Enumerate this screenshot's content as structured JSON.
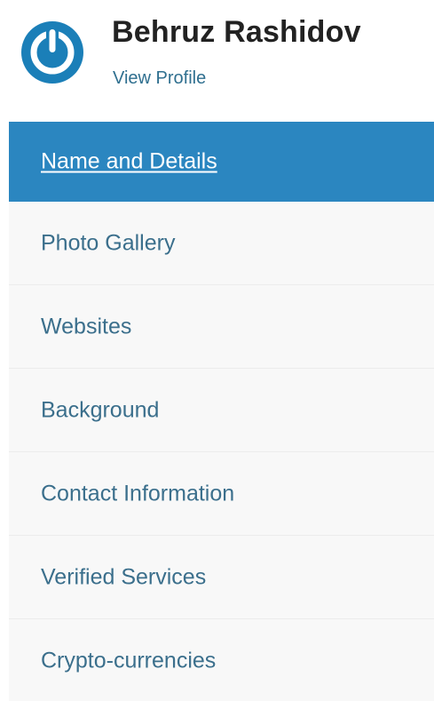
{
  "profile": {
    "name": "Behruz Rashidov",
    "view_profile_label": "View Profile",
    "logo_icon": "power-logo-icon",
    "accent_color": "#2b86c0"
  },
  "nav": {
    "active_index": 0,
    "items": [
      {
        "label": "Name and Details"
      },
      {
        "label": "Photo Gallery"
      },
      {
        "label": "Websites"
      },
      {
        "label": "Background"
      },
      {
        "label": "Contact Information"
      },
      {
        "label": "Verified Services"
      },
      {
        "label": "Crypto-currencies"
      }
    ]
  }
}
